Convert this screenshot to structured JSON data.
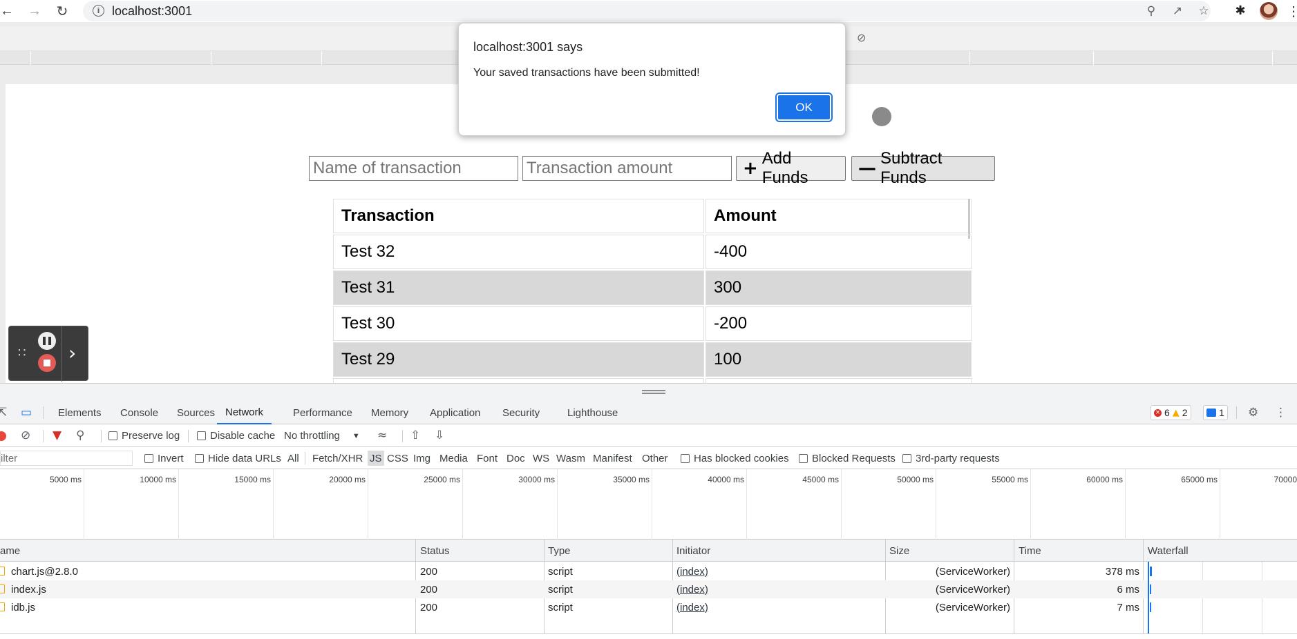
{
  "browser": {
    "url": "localhost:3001"
  },
  "app": {
    "inputs": {
      "name_placeholder": "Name of transaction",
      "amount_placeholder": "Transaction amount"
    },
    "add_label": "Add Funds",
    "subtract_label": "Subtract Funds",
    "table": {
      "headers": [
        "Transaction",
        "Amount"
      ],
      "rows": [
        {
          "name": "Test 32",
          "amount": "-400"
        },
        {
          "name": "Test 31",
          "amount": "300"
        },
        {
          "name": "Test 30",
          "amount": "-200"
        },
        {
          "name": "Test 29",
          "amount": "100"
        }
      ]
    }
  },
  "dialog": {
    "title": "localhost:3001 says",
    "message": "Your saved transactions have been submitted!",
    "ok_label": "OK"
  },
  "devtools": {
    "tabs": [
      "Elements",
      "Console",
      "Sources",
      "Network",
      "Performance",
      "Memory",
      "Application",
      "Security",
      "Lighthouse"
    ],
    "active_tab": "Network",
    "errors": "6",
    "warnings": "2",
    "messages": "1",
    "toolbar": {
      "preserve_log": "Preserve log",
      "disable_cache": "Disable cache",
      "throttling": "No throttling"
    },
    "filter": {
      "placeholder": "ilter",
      "invert": "Invert",
      "hide_data_urls": "Hide data URLs",
      "types": [
        "All",
        "Fetch/XHR",
        "JS",
        "CSS",
        "Img",
        "Media",
        "Font",
        "Doc",
        "WS",
        "Wasm",
        "Manifest",
        "Other"
      ],
      "selected_type": "JS",
      "blocked_cookies": "Has blocked cookies",
      "blocked_requests": "Blocked Requests",
      "third_party": "3rd-party requests"
    },
    "timeline_ticks": [
      "5000 ms",
      "10000 ms",
      "15000 ms",
      "20000 ms",
      "25000 ms",
      "30000 ms",
      "35000 ms",
      "40000 ms",
      "45000 ms",
      "50000 ms",
      "55000 ms",
      "60000 ms",
      "65000 ms",
      "70000"
    ],
    "columns": [
      "ame",
      "Status",
      "Type",
      "Initiator",
      "Size",
      "Time",
      "Waterfall"
    ],
    "requests": [
      {
        "name": "chart.js@2.8.0",
        "status": "200",
        "type": "script",
        "initiator": "(index)",
        "size": "(ServiceWorker)",
        "time": "378 ms"
      },
      {
        "name": "index.js",
        "status": "200",
        "type": "script",
        "initiator": "(index)",
        "size": "(ServiceWorker)",
        "time": "6 ms"
      },
      {
        "name": "idb.js",
        "status": "200",
        "type": "script",
        "initiator": "(index)",
        "size": "(ServiceWorker)",
        "time": "7 ms"
      }
    ]
  }
}
